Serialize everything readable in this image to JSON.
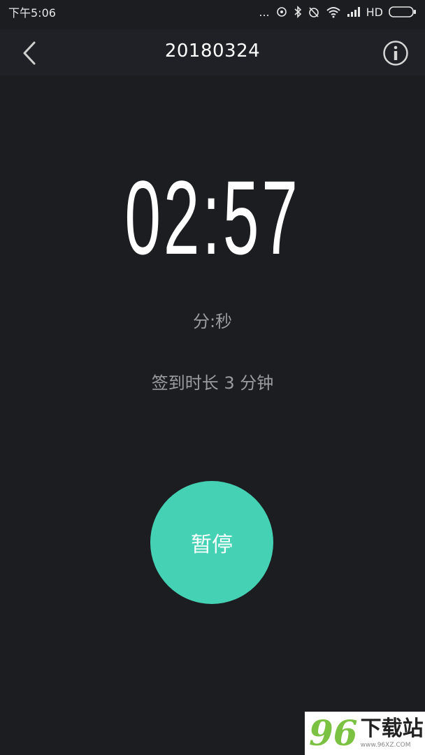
{
  "status_bar": {
    "time": "下午5:06",
    "dots": "...",
    "network_label": "HD"
  },
  "nav": {
    "title": "20180324",
    "back_icon": "chevron-left-icon",
    "info_icon": "info-icon"
  },
  "timer": {
    "display": "02:57",
    "unit_label": "分:秒",
    "duration_text": "签到时长 3 分钟"
  },
  "actions": {
    "pause_label": "暂停",
    "pause_color": "#45d2b4"
  },
  "watermark": {
    "logo": "96",
    "text": "下载站",
    "url": "www.96XZ.COM"
  }
}
